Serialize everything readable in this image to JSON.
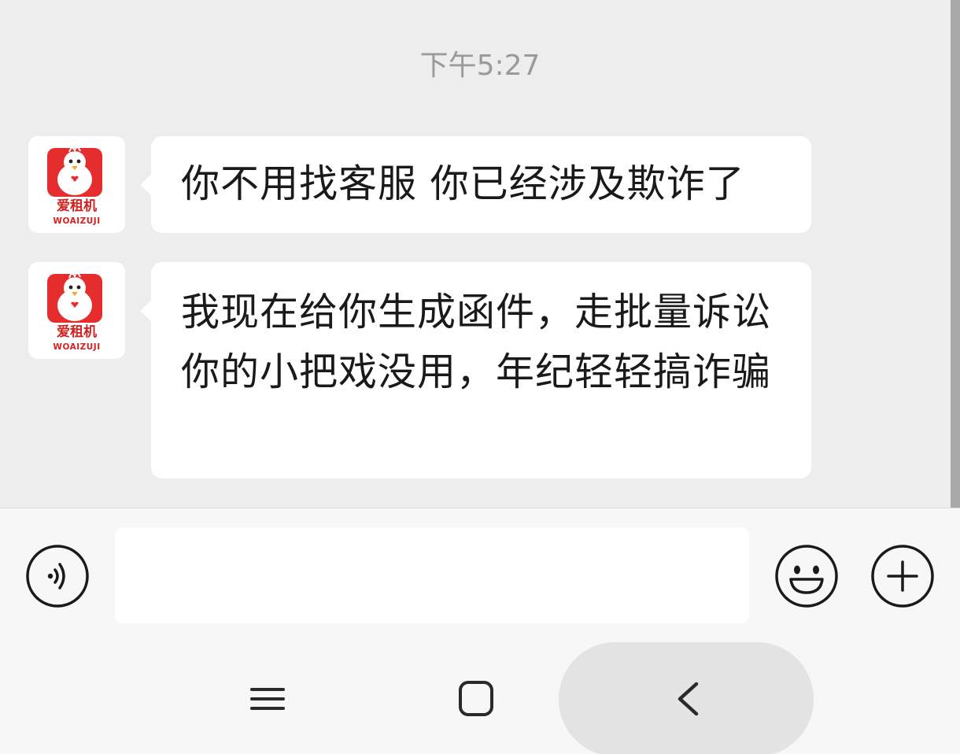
{
  "chat": {
    "timestamp": "下午5:27",
    "messages": [
      {
        "sender": "爱租机",
        "avatar_brand": "爱租机",
        "avatar_brand_en": "WOAIZUJI",
        "text": "你不用找客服 你已经涉及欺诈了"
      },
      {
        "sender": "爱租机",
        "avatar_brand": "爱租机",
        "avatar_brand_en": "WOAIZUJI",
        "text": "我现在给你生成函件，走批量诉讼 你的小把戏没用，年纪轻轻搞诈骗"
      }
    ]
  },
  "input_bar": {
    "voice_icon": "voice-icon",
    "input_value": "",
    "emoji_icon": "emoji-icon",
    "plus_icon": "plus-icon"
  },
  "nav_bar": {
    "recents_icon": "recents-icon",
    "home_icon": "home-icon",
    "back_icon": "back-icon"
  },
  "colors": {
    "background": "#ededed",
    "bubble": "#ffffff",
    "avatar_red": "#e52d2d",
    "text": "#1a1a1a",
    "timestamp": "#9a9a9a"
  }
}
